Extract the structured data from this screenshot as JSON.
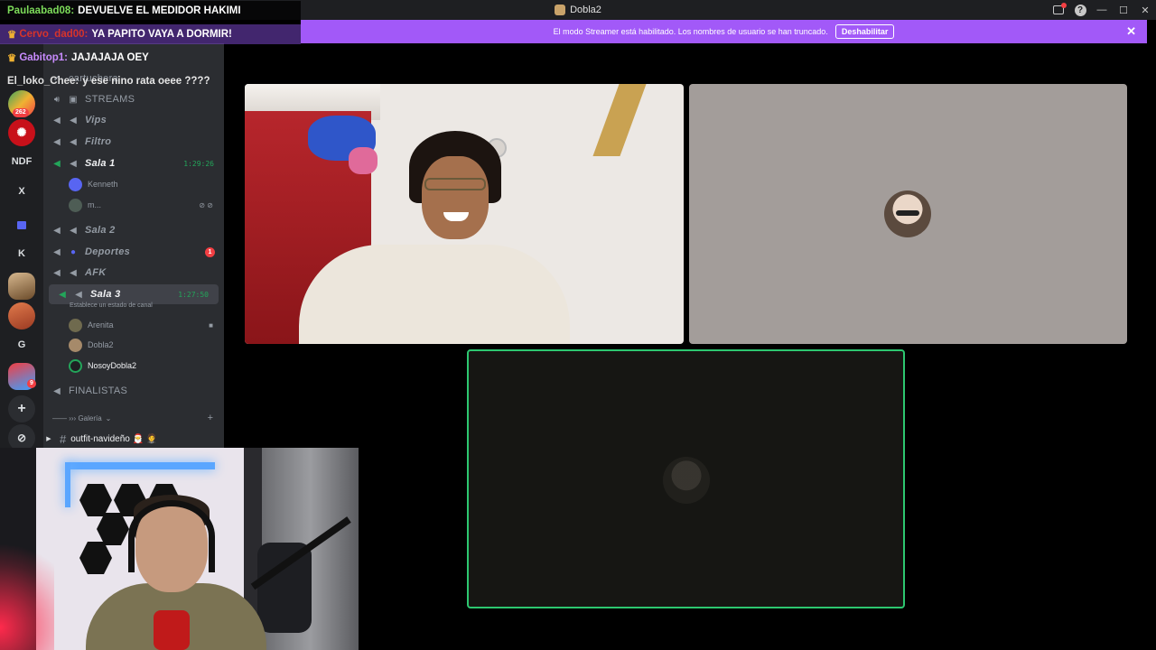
{
  "window": {
    "title": "Dobla2"
  },
  "banner": {
    "text": "El modo Streamer está habilitado. Los nombres de usuario se han truncado.",
    "button": "Deshabilitar",
    "close": "✕"
  },
  "chat": [
    {
      "user": "Paulaabad08:",
      "text": "DEVUELVE EL MEDIDOR HAKIMI",
      "user_color": "#7ddc5a"
    },
    {
      "user": "Cervo_dad00:",
      "text": "YA PAPITO VAYA A DORMIR!",
      "user_color": "#d6342b"
    },
    {
      "user": "Gabitop1:",
      "text": "JAJAJAJA OEY",
      "user_color": "#c98cff"
    },
    {
      "user": "El_loko_Chee:",
      "text": "y ese nino rata oeee ????",
      "user_color": "#e0e0e0"
    }
  ],
  "rail": {
    "items": [
      "NDF",
      "X",
      "K",
      "G"
    ],
    "badge_count": "262",
    "badge_3k": "3K+",
    "badge_9": "9",
    "add": "+"
  },
  "channels": {
    "top_user": "cartuchera",
    "list": [
      {
        "name": "STREAMS",
        "style": "plain"
      },
      {
        "name": "Vips"
      },
      {
        "name": "Filtro"
      },
      {
        "name": "Sala 1",
        "time": "1:29:26"
      },
      {
        "name": "Sala 2"
      },
      {
        "name": "Deportes",
        "badge": "1"
      },
      {
        "name": "AFK"
      },
      {
        "name": "Sala 3",
        "time": "1:27:50"
      },
      {
        "name": "FINALISTAS",
        "style": "plain"
      }
    ],
    "sala1_users": [
      "Kenneth",
      "m..."
    ],
    "sala3_status": "Establece un estado de canal",
    "sala3_users": [
      "Arenita",
      "Dobla2",
      "NosoyDobla2"
    ],
    "category": "—— ››› Galería",
    "text_channel": "outfit-navideño 🎅 🤵"
  }
}
